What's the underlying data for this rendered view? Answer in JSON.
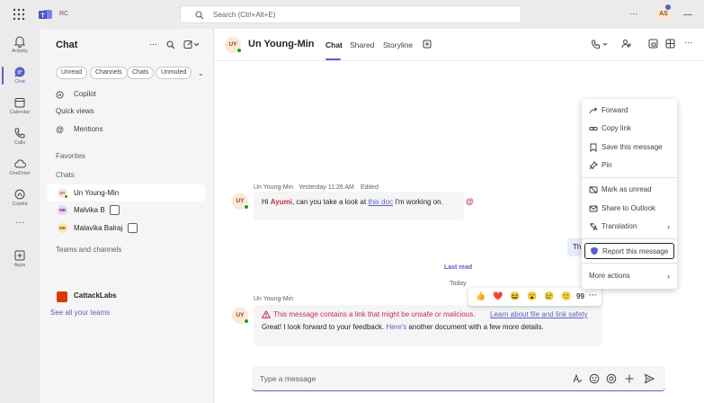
{
  "titlebar": {
    "app_short": "RC",
    "search_placeholder": "Search (Ctrl+Alt+E)",
    "user_initials": "AS",
    "more": "···",
    "minimize": "—",
    "close": "✕"
  },
  "rail": [
    {
      "label": "Activity",
      "icon": "bell-icon"
    },
    {
      "label": "Chat",
      "icon": "chat-icon",
      "active": true
    },
    {
      "label": "Calendar",
      "icon": "calendar-icon"
    },
    {
      "label": "Calls",
      "icon": "phone-icon"
    },
    {
      "label": "OneDrive",
      "icon": "cloud-icon"
    },
    {
      "label": "Copilot",
      "icon": "copilot-icon"
    },
    {
      "label": "···",
      "icon": "more-icon"
    },
    {
      "label": "Apps",
      "icon": "apps-icon"
    }
  ],
  "chatpane": {
    "title": "Chat",
    "filters": [
      "Unread",
      "Channels",
      "Chats",
      "Unmuted"
    ],
    "copilot": "Copilot",
    "quick_views": "Quick views",
    "mentions": "Mentions",
    "favorites": "Favorites",
    "chats_section": "Chats",
    "chats": [
      {
        "name": "Un Young-Min",
        "initials": "UY",
        "selected": true
      },
      {
        "name": "Malvika B",
        "initials": "MB"
      },
      {
        "name": "Malavika Balraj",
        "initials": "MB"
      }
    ],
    "teams_section": "Teams and channels",
    "team": "CattackLabs",
    "see_all": "See all your teams"
  },
  "conversation": {
    "contact": "Un Young-Min",
    "initials": "UY",
    "tabs": [
      "Chat",
      "Shared",
      "Storyline"
    ],
    "msg1": {
      "sender": "Un Young-Min",
      "time": "Yesterday 11:26 AM",
      "edited": "Edited",
      "hi": "Hi",
      "mention": "Ayumi",
      "text_a": ", can you take a look at",
      "link": "this doc",
      "text_b": "I'm working on.",
      "at": "@"
    },
    "own_msg_fragment": "Th",
    "last_read": "Last read",
    "today": "Today",
    "msg2": {
      "sender": "Un Young-Min",
      "warning": "This message contains a link that might be unsafe or malicious.",
      "learn_more": "Learn about file and link safety",
      "text_a": "Great! I look forward to your feedback.",
      "link": "Here's",
      "text_b": "another document with a few more details."
    },
    "reactions": [
      "👍",
      "❤️",
      "😆",
      "😮",
      "😢",
      "🙂",
      "99",
      "···"
    ]
  },
  "context_menu": {
    "items": [
      {
        "label": "Forward",
        "icon": "forward-icon"
      },
      {
        "label": "Copy link",
        "icon": "link-icon"
      },
      {
        "label": "Save this message",
        "icon": "bookmark-icon"
      },
      {
        "label": "Pin",
        "icon": "pin-icon"
      },
      {
        "label": "Mark as unread",
        "icon": "unread-icon"
      },
      {
        "label": "Share to Outlook",
        "icon": "mail-icon"
      },
      {
        "label": "Translation",
        "icon": "translate-icon",
        "submenu": true
      },
      {
        "label": "Report this message",
        "icon": "shield-icon",
        "focused": true
      },
      {
        "label": "More actions",
        "submenu": true
      }
    ]
  },
  "compose": {
    "placeholder": "Type a message"
  },
  "colors": {
    "accent": "#5b5fc7",
    "warning": "#c4314b",
    "online": "#13a10e",
    "team": "#d83b01"
  }
}
